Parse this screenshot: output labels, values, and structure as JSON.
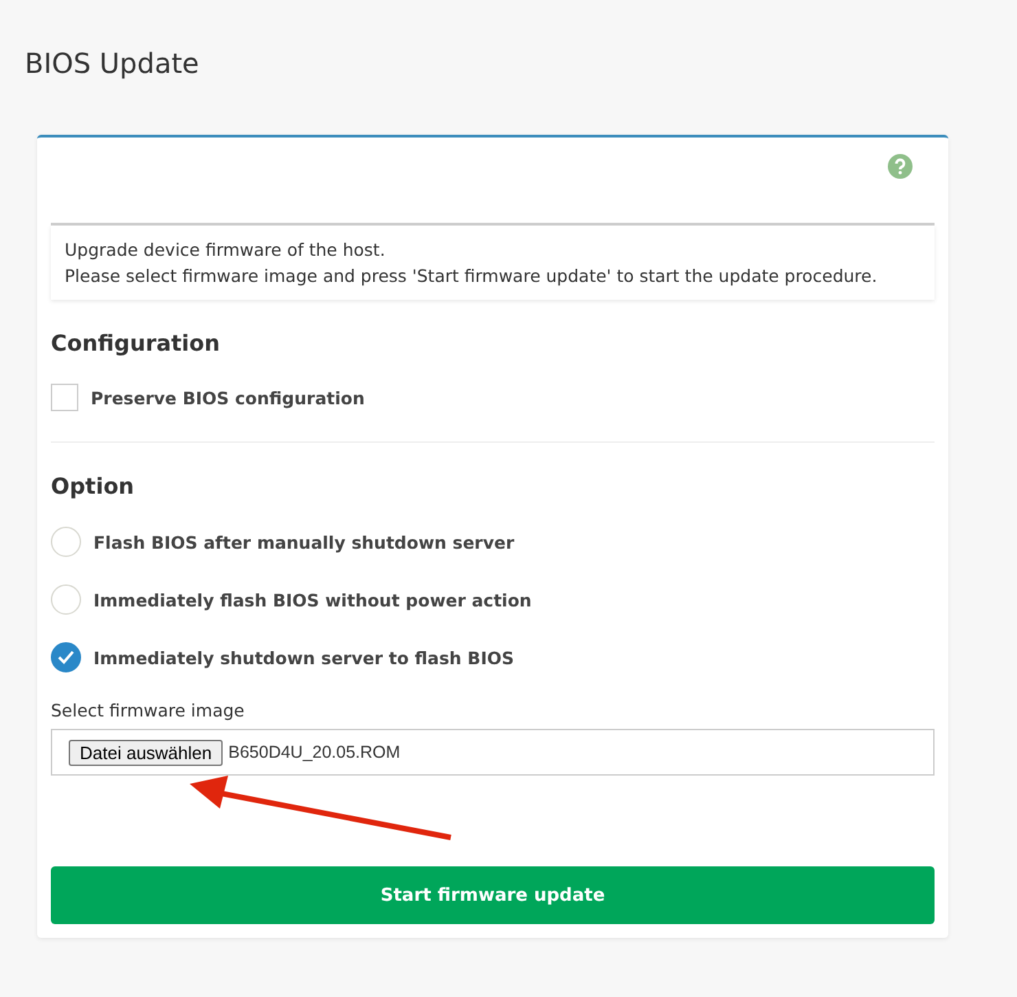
{
  "page": {
    "title": "BIOS Update"
  },
  "info": {
    "lines": [
      "Upgrade device firmware of the host.",
      "Please select firmware image and press 'Start firmware update' to start the update procedure."
    ]
  },
  "configuration": {
    "heading": "Configuration",
    "checkbox": {
      "label": "Preserve BIOS configuration",
      "checked": false
    }
  },
  "option": {
    "heading": "Option",
    "radios": [
      {
        "label": "Flash BIOS after manually shutdown server",
        "selected": false
      },
      {
        "label": "Immediately flash BIOS without power action",
        "selected": false
      },
      {
        "label": "Immediately shutdown server to flash BIOS",
        "selected": true
      }
    ]
  },
  "file": {
    "label": "Select firmware image",
    "button": "Datei auswählen",
    "value": "B650D4U_20.05.ROM"
  },
  "submit": {
    "label": "Start firmware update"
  }
}
